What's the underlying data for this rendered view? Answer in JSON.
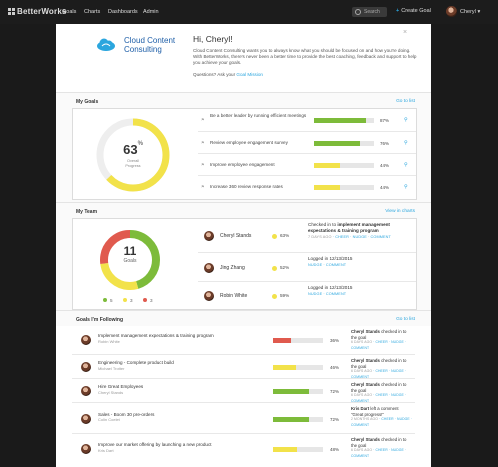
{
  "topbar": {
    "logo": "BetterWorks",
    "nav": [
      "Goals",
      "Charts",
      "Dashboards",
      "Admin"
    ],
    "search_placeholder": "Search",
    "create_goal": "Create Goal",
    "user_name": "Cheryl"
  },
  "welcome": {
    "company_line1": "Cloud Content",
    "company_line2": "Consulting",
    "greeting": "Hi, Cheryl!",
    "body": "Cloud Content Consulting wants you to always know what you should be focused on and how you're doing. With BetterWorks, there's never been a better time to provide the best coaching, feedback and support to help you achieve your goals.",
    "question": "Questions? Ask your",
    "question_link": "Goal Mission"
  },
  "my_goals": {
    "title": "My Goals",
    "link": "Go to list",
    "overall_pct": "63",
    "overall_label1": "Overall",
    "overall_label2": "Progress",
    "overall_value": 0.63,
    "goals": [
      {
        "name": "Be a better leader by running efficient meetings",
        "pct": "87%",
        "value": 0.87,
        "color": "#7dbb3a"
      },
      {
        "name": "Review employee engagement survey",
        "pct": "76%",
        "value": 0.76,
        "color": "#7dbb3a"
      },
      {
        "name": "Improve employee engagement",
        "pct": "44%",
        "value": 0.44,
        "color": "#f2e24a"
      },
      {
        "name": "Increase 360 review response rates",
        "pct": "44%",
        "value": 0.44,
        "color": "#f2e24a"
      }
    ]
  },
  "my_team": {
    "title": "My Team",
    "link": "View in charts",
    "count": "11",
    "count_label": "Goals",
    "legend": [
      {
        "count": "5",
        "color": "#7dbb3a"
      },
      {
        "count": "3",
        "color": "#f2e24a"
      },
      {
        "count": "3",
        "color": "#e05a4e"
      }
    ],
    "members": [
      {
        "name": "Cheryl Stands",
        "pct": "63%",
        "activity_prefix": "Checked in to",
        "activity_bold": "implement management expectations & training program",
        "meta_date": "7 DAYS AGO",
        "meta_links": "CHEER · NUDGE · COMMENT"
      },
      {
        "name": "Jing Zhang",
        "pct": "52%",
        "activity_prefix": "Logged in 12/13/2015",
        "activity_bold": "",
        "meta_date": "",
        "meta_links": "NUDGE · COMMENT"
      },
      {
        "name": "Robin White",
        "pct": "59%",
        "activity_prefix": "Logged in 12/13/2015",
        "activity_bold": "",
        "meta_date": "",
        "meta_links": "NUDGE · COMMENT"
      }
    ]
  },
  "following": {
    "title": "Goals I'm Following",
    "link": "Go to list",
    "goals": [
      {
        "name": "Implement management expectations & training program",
        "owner": "Robin White",
        "pct": "36%",
        "value": 0.36,
        "color": "#e05a4e",
        "actor": "Cheryl Stands",
        "action": "checked in to the goal",
        "quote": "",
        "meta_date": "6 DAYS AGO",
        "meta_links": "CHEER · NUDGE · COMMENT"
      },
      {
        "name": "Engineering - Complete product build",
        "owner": "Michael Trotter",
        "pct": "46%",
        "value": 0.46,
        "color": "#f2e24a",
        "actor": "Cheryl Stands",
        "action": "checked in to the goal",
        "quote": "",
        "meta_date": "6 DAYS AGO",
        "meta_links": "CHEER · NUDGE · COMMENT"
      },
      {
        "name": "Hire Great Employees",
        "owner": "Cheryl Stands",
        "pct": "72%",
        "value": 0.72,
        "color": "#7dbb3a",
        "actor": "Cheryl Stands",
        "action": "checked in to the goal",
        "quote": "",
        "meta_date": "6 DAYS AGO",
        "meta_links": "CHEER · NUDGE · COMMENT"
      },
      {
        "name": "Sales - Boom 30 pre-orders",
        "owner": "Colin Coelet",
        "pct": "72%",
        "value": 0.72,
        "color": "#7dbb3a",
        "actor": "Kris Dart",
        "action": "left a comment",
        "quote": "\"Great progress!\"",
        "meta_date": "2 MONTHS AGO",
        "meta_links": "CHEER · NUDGE · COMMENT"
      },
      {
        "name": "Improve our market offering by launching a new product",
        "owner": "Kris Dart",
        "pct": "48%",
        "value": 0.48,
        "color": "#f2e24a",
        "actor": "Cheryl Stands",
        "action": "checked in to the goal",
        "quote": "",
        "meta_date": "6 DAYS AGO",
        "meta_links": "CHEER · NUDGE · COMMENT"
      }
    ]
  }
}
